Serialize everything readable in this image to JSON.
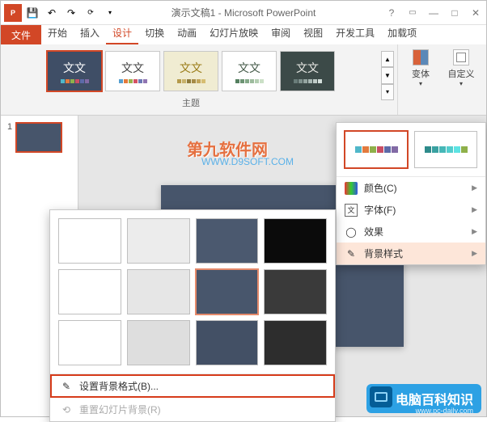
{
  "title": "演示文稿1 - Microsoft PowerPoint",
  "tabs": {
    "file": "文件",
    "items": [
      "开始",
      "插入",
      "设计",
      "切换",
      "动画",
      "幻灯片放映",
      "审阅",
      "视图",
      "开发工具",
      "加载项"
    ],
    "active_index": 2
  },
  "ribbon": {
    "themes_label": "主题",
    "theme_text": "文文",
    "variant_btn": "变体",
    "customize_btn": "自定义"
  },
  "slide": {
    "number": "1"
  },
  "watermark": {
    "line1": "第九软件网",
    "line2": "WWW.D9SOFT.COM"
  },
  "variants_popup": {
    "colors": "颜色(C)",
    "fonts": "字体(F)",
    "effects": "效果",
    "bg_styles": "背景样式"
  },
  "bg_flyout": {
    "cells": [
      {
        "bg": "#ffffff",
        "sel": false
      },
      {
        "bg": "#ececec",
        "sel": false
      },
      {
        "bg": "#4b596f",
        "sel": false
      },
      {
        "bg": "#0b0b0b",
        "sel": false
      },
      {
        "bg": "#ffffff",
        "sel": false
      },
      {
        "bg": "#e6e6e6",
        "sel": false
      },
      {
        "bg": "#48566c",
        "sel": true
      },
      {
        "bg": "#3a3a3a",
        "sel": false
      },
      {
        "bg": "#ffffff",
        "sel": false
      },
      {
        "bg": "#dedede",
        "sel": false
      },
      {
        "bg": "#435065",
        "sel": false
      },
      {
        "bg": "#2d2d2d",
        "sel": false
      }
    ],
    "format_bg": "设置背景格式(B)...",
    "reset_bg": "重置幻灯片背景(R)"
  },
  "site_logo": {
    "text": "电脑百科知识",
    "url": "www.pc-daily.com"
  },
  "themes": [
    {
      "bg": "#3f4e66",
      "fg": "#ffffff",
      "swatches": [
        "#50b7c9",
        "#e27a3e",
        "#8fb04a",
        "#c94e64",
        "#5d6aa8",
        "#826aa5"
      ],
      "selected": true
    },
    {
      "bg": "#ffffff",
      "fg": "#444444",
      "swatches": [
        "#55a0d0",
        "#e57a3b",
        "#99b24d",
        "#d45264",
        "#6d78b5",
        "#9075b2"
      ],
      "selected": false
    },
    {
      "bg": "#f0ecd2",
      "fg": "#9a7c18",
      "swatches": [
        "#b59a4b",
        "#c8b26b",
        "#8f7b3b",
        "#a68b47",
        "#c1a45a",
        "#d6bd72"
      ],
      "selected": false
    },
    {
      "bg": "#ffffff",
      "fg": "#445a48",
      "swatches": [
        "#558060",
        "#6d9474",
        "#84a888",
        "#9dbb9d",
        "#b4ceb2",
        "#cbe0c7"
      ],
      "selected": false
    },
    {
      "bg": "#3c4a48",
      "fg": "#e8e8e4",
      "swatches": [
        "#6a7d7a",
        "#7f918d",
        "#95a5a1",
        "#aab9b5",
        "#c0ccc8",
        "#d5e0dc"
      ],
      "selected": false
    }
  ],
  "variant_swatches": {
    "a": [
      "#50b7c9",
      "#e27a3e",
      "#8fb04a",
      "#c94e64",
      "#5d6aa8",
      "#826aa5"
    ],
    "b": [
      "#2e8b8b",
      "#3aa1a1",
      "#46b7b7",
      "#52cdcd",
      "#5ee3e3",
      "#8fb04a"
    ]
  }
}
